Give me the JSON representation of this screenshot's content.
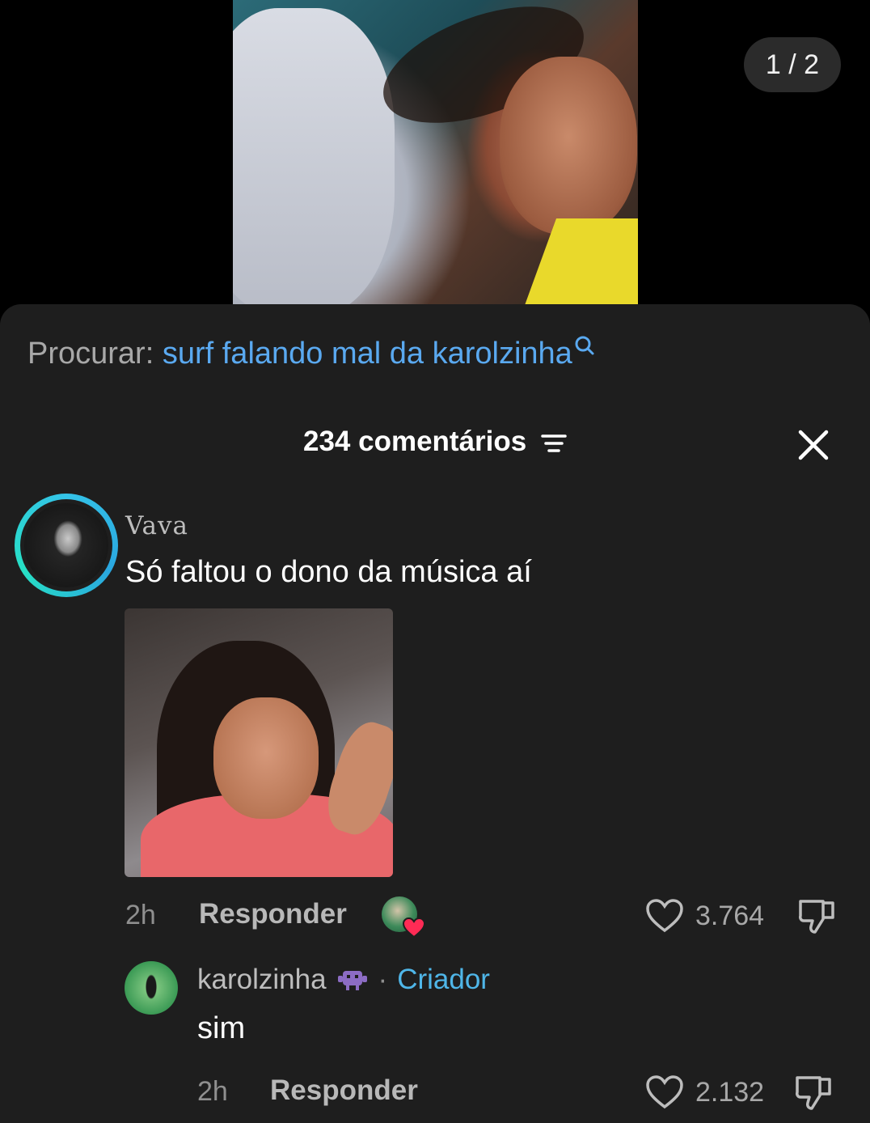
{
  "media": {
    "pager": "1 / 2"
  },
  "search": {
    "label": "Procurar:",
    "query": "surf falando mal da karolzinha"
  },
  "comments_header": {
    "count_label": "234 comentários"
  },
  "comment": {
    "author": "Vava",
    "text": "Só faltou o dono da música aí",
    "time": "2h",
    "reply_label": "Responder",
    "likes": "3.764"
  },
  "reply": {
    "author": "karolzinha",
    "separator": "·",
    "badge": "Criador",
    "text": "sim",
    "time": "2h",
    "reply_label": "Responder",
    "likes": "2.132"
  },
  "colors": {
    "accent_blue": "#5aa9f0",
    "creator_blue": "#4fb6e8",
    "heart_red": "#ff2b55"
  }
}
